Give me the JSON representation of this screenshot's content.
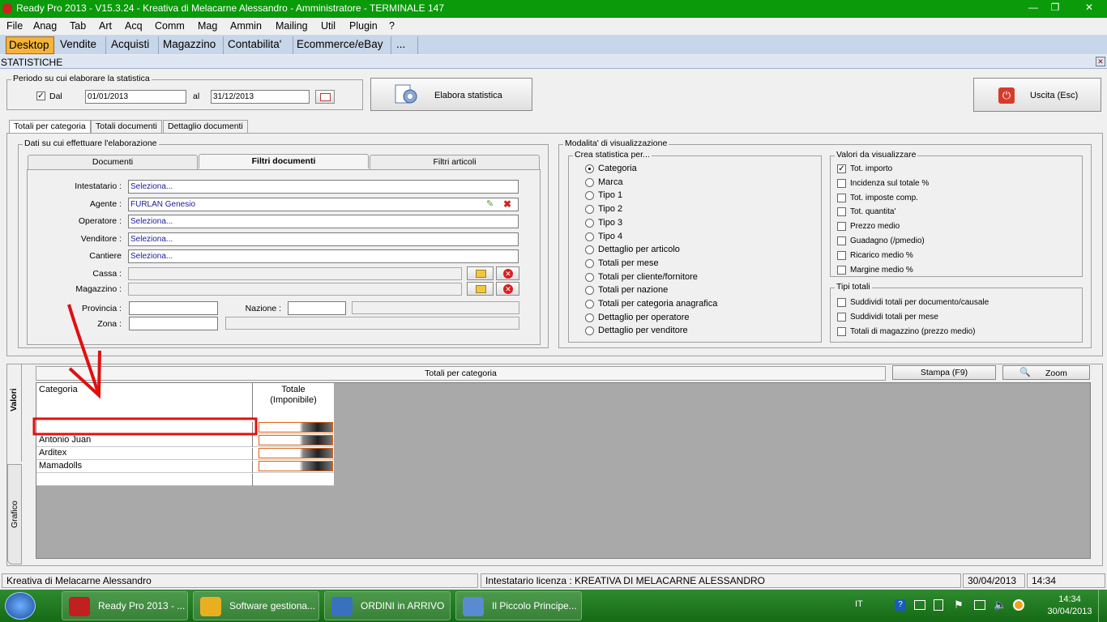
{
  "window": {
    "title": "Ready Pro 2013 - V15.3.24 - Kreativa di Melacarne Alessandro - Amministratore - TERMINALE 147"
  },
  "menu": [
    "File",
    "Anag",
    "Tab",
    "Art",
    "Acq",
    "Comm",
    "Mag",
    "Ammin",
    "Mailing",
    "Util",
    "Plugin",
    "?"
  ],
  "tabs": [
    "Desktop",
    "Vendite",
    "Acquisti",
    "Magazzino",
    "Contabilita'",
    "Ecommerce/eBay",
    "..."
  ],
  "section_title": "STATISTICHE",
  "period": {
    "group_label": "Periodo su cui elaborare la statistica",
    "dal_label": "Dal",
    "dal_checked": true,
    "from": "01/01/2013",
    "al_label": "al",
    "to": "31/12/2013",
    "calendar_icon": "calendar-icon"
  },
  "buttons": {
    "elabora": "Elabora statistica",
    "uscita": "Uscita (Esc)",
    "stampa": "Stampa (F9)",
    "zoom": "Zoom"
  },
  "report_tabs": [
    "Totali per categoria",
    "Totali documenti",
    "Dettaglio documenti"
  ],
  "dati": {
    "group_label": "Dati su cui effettuare l'elaborazione",
    "subtabs": [
      "Documenti",
      "Filtri documenti",
      "Filtri articoli"
    ],
    "fields": {
      "intestatario": {
        "label": "Intestatario :",
        "value": "Seleziona..."
      },
      "agente": {
        "label": "Agente :",
        "value": "FURLAN Genesio"
      },
      "operatore": {
        "label": "Operatore :",
        "value": "Seleziona..."
      },
      "venditore": {
        "label": "Venditore :",
        "value": "Seleziona..."
      },
      "cantiere": {
        "label": "Cantiere",
        "value": "Seleziona..."
      },
      "cassa": {
        "label": "Cassa :"
      },
      "magazzino": {
        "label": "Magazzino :"
      },
      "provincia": {
        "label": "Provincia :"
      },
      "nazione": {
        "label": "Nazione :"
      },
      "zona": {
        "label": "Zona :"
      }
    }
  },
  "modalita": {
    "group_label": "Modalita' di visualizzazione",
    "crea": {
      "label": "Crea statistica per...",
      "selected": 0,
      "options": [
        "Categoria",
        "Marca",
        "Tipo 1",
        "Tipo 2",
        "Tipo 3",
        "Tipo 4",
        "Dettaglio per articolo",
        "Totali per mese",
        "Totali per cliente/fornitore",
        "Totali per nazione",
        "Totali per categoria anagrafica",
        "Dettaglio per operatore",
        "Dettaglio per venditore"
      ]
    },
    "valori": {
      "label": "Valori da visualizzare",
      "options": [
        {
          "label": "Tot. importo",
          "checked": true
        },
        {
          "label": "Incidenza sul totale %",
          "checked": false
        },
        {
          "label": "Tot. imposte comp.",
          "checked": false
        },
        {
          "label": "Tot. quantita'",
          "checked": false
        },
        {
          "label": "Prezzo medio",
          "checked": false
        },
        {
          "label": "Guadagno (/pmedio)",
          "checked": false
        },
        {
          "label": "Ricarico medio %",
          "checked": false
        },
        {
          "label": "Margine medio %",
          "checked": false
        }
      ]
    },
    "tipi": {
      "label": "Tipi totali",
      "options": [
        {
          "label": "Suddividi totali per documento/causale",
          "checked": false
        },
        {
          "label": "Suddividi totali per mese",
          "checked": false
        },
        {
          "label": "Totali di magazzino (prezzo medio)",
          "checked": false
        }
      ]
    }
  },
  "results": {
    "side_tabs": [
      "Valori",
      "Grafico"
    ],
    "title": "Totali per categoria",
    "columns": [
      "Categoria",
      "Totale\n(Imponibile)"
    ],
    "rows": [
      "",
      "Antonio Juan",
      "Arditex",
      "Mamadolls",
      ""
    ]
  },
  "status": {
    "company": "Kreativa di Melacarne Alessandro",
    "license": "Intestatario licenza : KREATIVA DI MELACARNE ALESSANDRO",
    "date": "30/04/2013",
    "time": "14:34"
  },
  "taskbar": {
    "items": [
      {
        "label": "Ready Pro 2013 - ...",
        "color": "#c02020"
      },
      {
        "label": "Software gestiona...",
        "color": "#e8b020"
      },
      {
        "label": "ORDINI in ARRIVO",
        "color": "#3a70c0"
      },
      {
        "label": "Il Piccolo Principe...",
        "color": "#5a8ad0"
      }
    ],
    "lang": "IT",
    "clock_time": "14:34",
    "clock_date": "30/04/2013"
  },
  "colors": {
    "title_green": "#0a9a0a",
    "active_tab": "#f5b33c",
    "annotation_red": "#e01010"
  }
}
